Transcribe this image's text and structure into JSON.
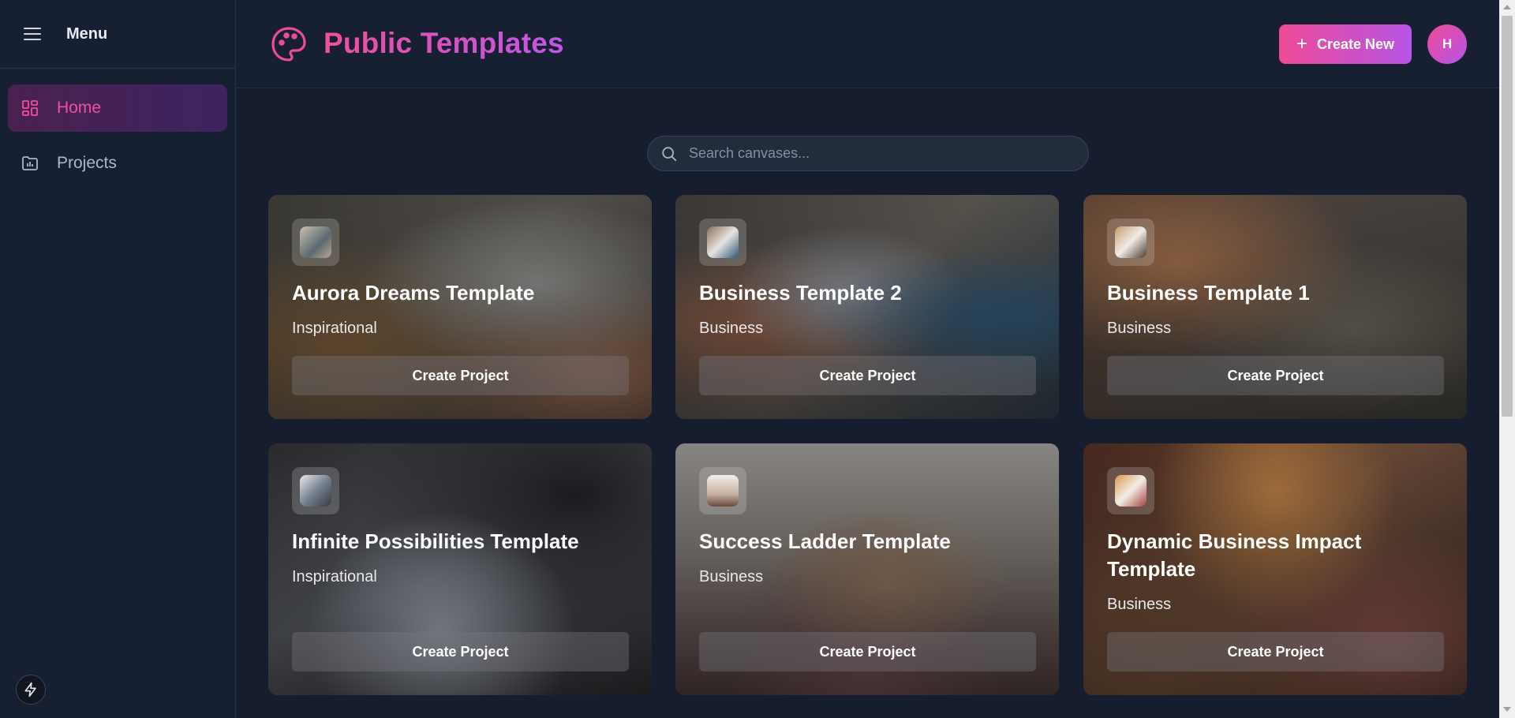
{
  "sidebar": {
    "title": "Menu",
    "items": [
      {
        "label": "Home",
        "icon": "dashboard-icon",
        "active": true
      },
      {
        "label": "Projects",
        "icon": "folder-chart-icon",
        "active": false
      }
    ]
  },
  "header": {
    "title": "Public Templates",
    "create_label": "Create New",
    "avatar_initial": "H"
  },
  "search": {
    "placeholder": "Search canvases..."
  },
  "cards": [
    {
      "title": "Aurora Dreams Template",
      "category": "Inspirational",
      "button": "Create Project"
    },
    {
      "title": "Business Template 2",
      "category": "Business",
      "button": "Create Project"
    },
    {
      "title": "Business Template 1",
      "category": "Business",
      "button": "Create Project"
    },
    {
      "title": "Infinite Possibilities Template",
      "category": "Inspirational",
      "button": "Create Project"
    },
    {
      "title": "Success Ladder Template",
      "category": "Business",
      "button": "Create Project"
    },
    {
      "title": "Dynamic Business Impact Template",
      "category": "Business",
      "button": "Create Project"
    }
  ],
  "colors": {
    "accent_pink": "#ee4b96",
    "accent_purple": "#b655e6",
    "background": "#151d2e",
    "sidebar": "#172033"
  }
}
